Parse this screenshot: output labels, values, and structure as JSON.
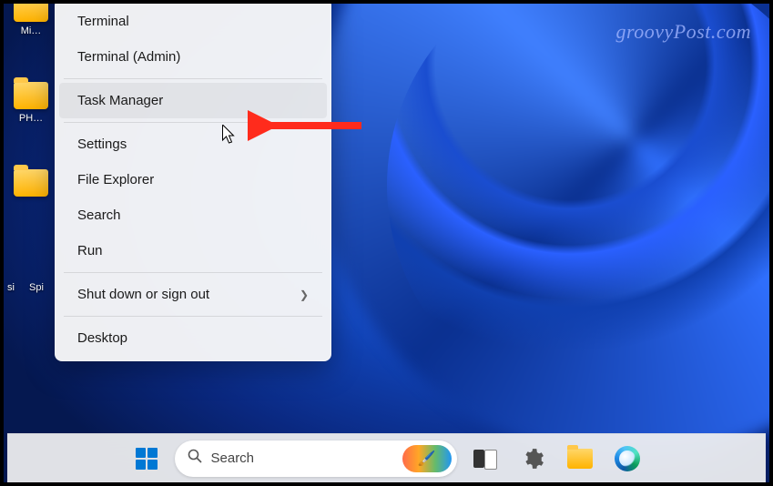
{
  "watermark": "groovyPost.com",
  "desktop_icons": [
    {
      "label": "Mi…"
    },
    {
      "label": "PH…"
    },
    {
      "label": ""
    }
  ],
  "desktop_icon_partials": {
    "si": "si",
    "spi": "Spi"
  },
  "menu": {
    "items": [
      {
        "label": "Terminal",
        "submenu": false
      },
      {
        "label": "Terminal (Admin)",
        "submenu": false
      },
      {
        "label": "Task Manager",
        "submenu": false,
        "hovered": true
      },
      {
        "label": "Settings",
        "submenu": false
      },
      {
        "label": "File Explorer",
        "submenu": false
      },
      {
        "label": "Search",
        "submenu": false
      },
      {
        "label": "Run",
        "submenu": false
      },
      {
        "label": "Shut down or sign out",
        "submenu": true
      },
      {
        "label": "Desktop",
        "submenu": false
      }
    ]
  },
  "taskbar": {
    "search_placeholder": "Search"
  }
}
